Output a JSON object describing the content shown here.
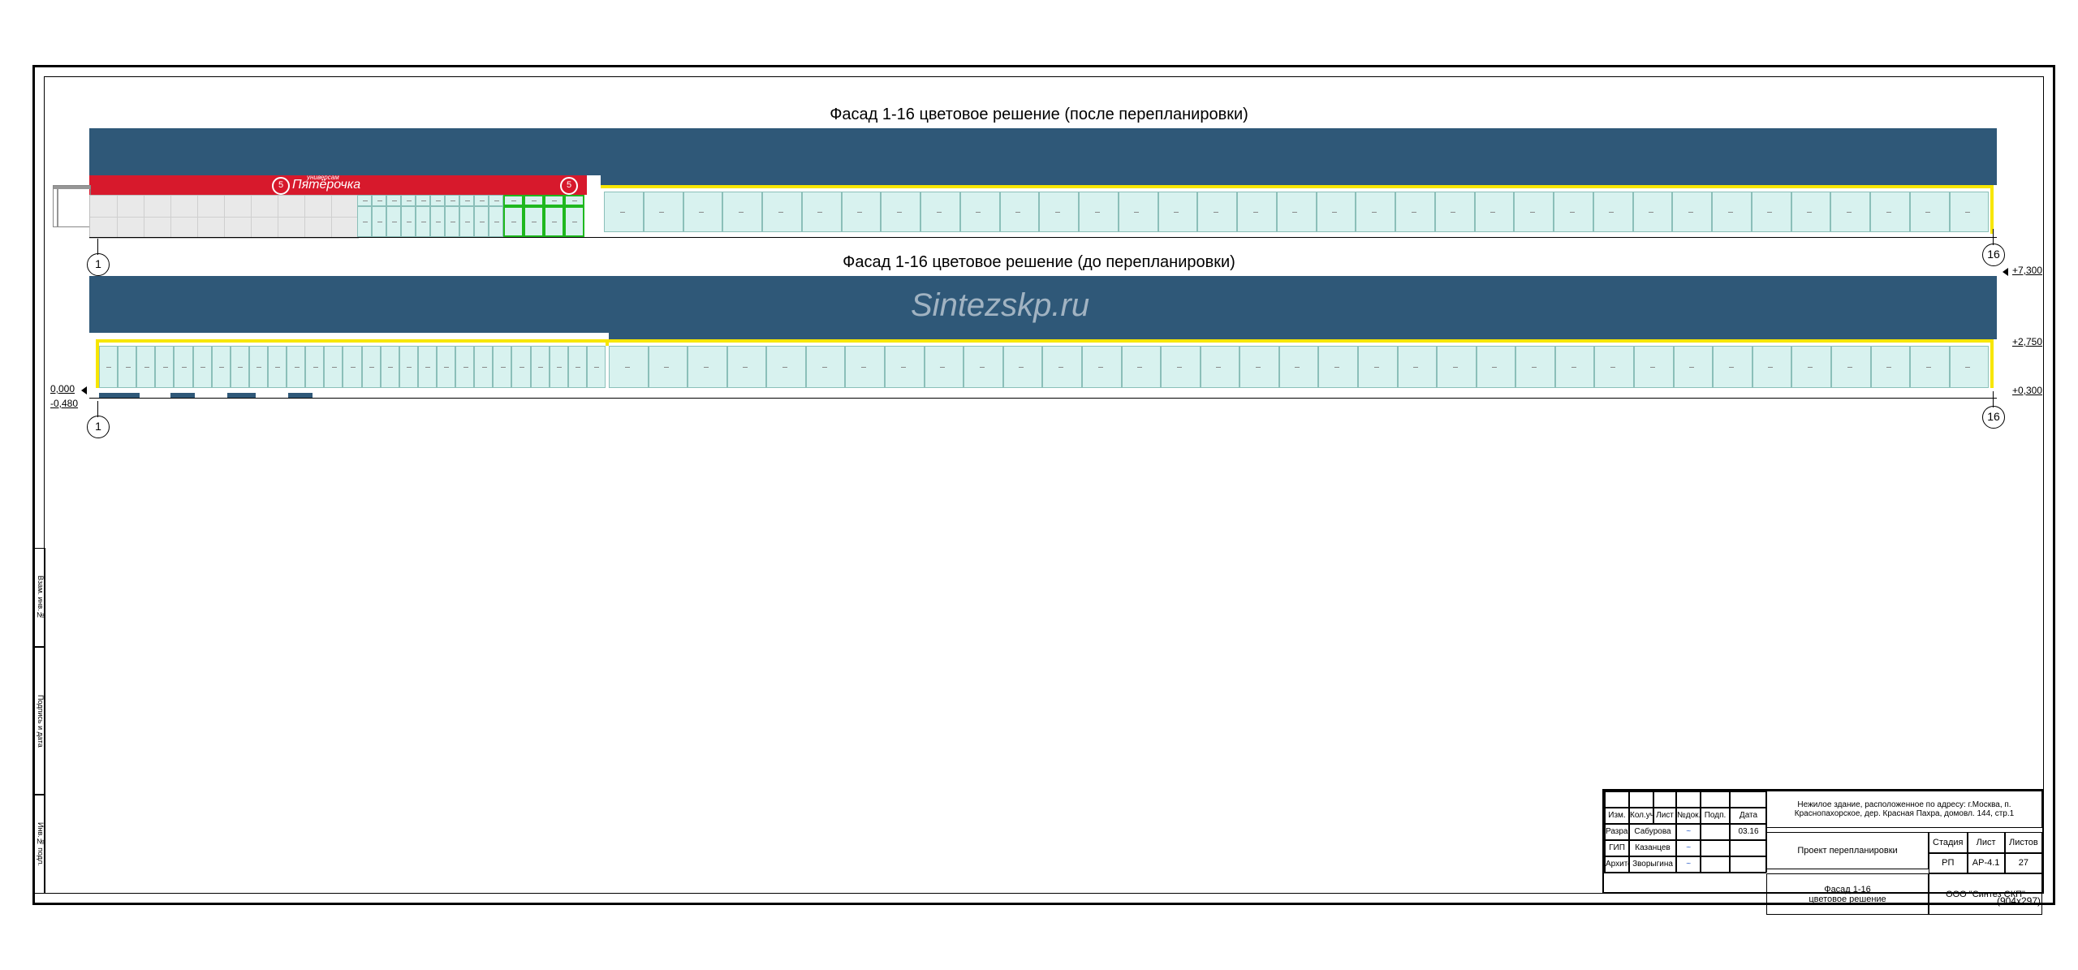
{
  "sheet": {
    "dimensions_label": "(904x297)"
  },
  "watermark": "Sintezskp.ru",
  "titles": {
    "top": "Фасад 1-16 цветовое решение (после перепланировки)",
    "bottom": "Фасад 1-16 цветовое решение (до перепланировки)"
  },
  "axes": {
    "left": "1",
    "right": "16"
  },
  "elevations": {
    "top_right": "+7,300",
    "mid_right": "+2,750",
    "bot_right": "+0,300",
    "bot_left_zero": "0,000",
    "bot_left_neg": "-0,480"
  },
  "brand": {
    "name": "Пятёрочка",
    "sub": "универсам",
    "logo": "5"
  },
  "side_labels": {
    "inv": "Инв.№ подл.",
    "sign": "Подпись и дата",
    "vzam": "Взам. инв.№"
  },
  "title_block": {
    "address": "Нежилое здание, расположенное по адресу: г.Москва, п. Краснопахорское, дер. Красная Пахра, домовл. 144, стр.1",
    "project_type": "Проект перепланировки",
    "drawing_title_1": "Фасад 1-16",
    "drawing_title_2": "цветовое решение",
    "org": "ООО \"Синтез СКП\"",
    "stage_label": "Стадия",
    "sheet_label": "Лист",
    "sheets_label": "Листов",
    "stage": "РП",
    "sheet": "АР-4.1",
    "sheets": "27",
    "rev_headers": [
      "Изм.",
      "Кол.уч",
      "Лист",
      "№док.",
      "Подп.",
      "Дата"
    ],
    "roles": [
      "Разраб.",
      "ГИП",
      "Архитектор"
    ],
    "names": [
      "Сабурова",
      "Казанцев",
      "Зворыгина"
    ],
    "date": "03.16"
  }
}
